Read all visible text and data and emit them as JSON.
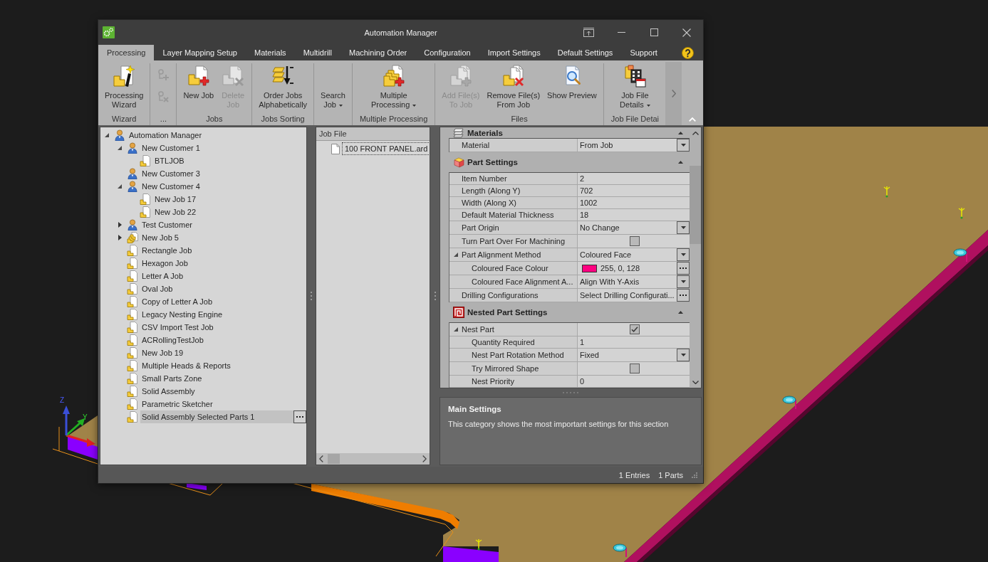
{
  "viewport": {
    "axis_labels": [
      "Z",
      "Y"
    ]
  },
  "window": {
    "title": "Automation Manager"
  },
  "tabs": [
    {
      "label": "Processing",
      "selected": true
    },
    {
      "label": "Layer Mapping Setup",
      "selected": false
    },
    {
      "label": "Materials",
      "selected": false
    },
    {
      "label": "Multidrill",
      "selected": false
    },
    {
      "label": "Machining Order",
      "selected": false
    },
    {
      "label": "Configuration",
      "selected": false
    },
    {
      "label": "Import Settings",
      "selected": false
    },
    {
      "label": "Default Settings",
      "selected": false
    },
    {
      "label": "Support",
      "selected": false
    }
  ],
  "ribbon": {
    "groups": [
      {
        "label": "Wizard",
        "buttons": [
          {
            "kind": "wizard",
            "lines": [
              "Processing",
              "Wizard"
            ],
            "disabled": false,
            "dropdown": false
          }
        ]
      },
      {
        "label": "...",
        "buttons": [
          {
            "kind": "smalladd",
            "disabled": true
          },
          {
            "kind": "smallremove",
            "disabled": true
          }
        ]
      },
      {
        "label": "Jobs",
        "buttons": [
          {
            "kind": "create",
            "lines": [
              "New Job"
            ],
            "disabled": false,
            "dropdown": false
          },
          {
            "kind": "delete",
            "lines": [
              "Delete",
              "Job"
            ],
            "disabled": true,
            "dropdown": false
          }
        ]
      },
      {
        "label": "Jobs Sorting",
        "buttons": [
          {
            "kind": "sort",
            "lines": [
              "Order Jobs",
              "Alphabetically"
            ],
            "disabled": false,
            "dropdown": false
          }
        ]
      },
      {
        "buttons": [
          {
            "kind": "plain",
            "lines": [
              "Search",
              "Job"
            ],
            "disabled": false,
            "dropdown": true
          }
        ]
      },
      {
        "label": "Multiple Processing",
        "buttons": [
          {
            "kind": "batch",
            "lines": [
              "Multiple",
              "Processing"
            ],
            "disabled": false,
            "dropdown": true
          }
        ]
      },
      {
        "label": "Files",
        "buttons": [
          {
            "kind": "addfiles",
            "lines": [
              "Add File(s)",
              "To Job"
            ],
            "disabled": true,
            "dropdown": false
          },
          {
            "kind": "removefiles",
            "lines": [
              "Remove File(s)",
              "From Job"
            ],
            "disabled": false,
            "dropdown": false
          },
          {
            "kind": "preview",
            "lines": [
              "Show Preview"
            ],
            "disabled": false,
            "dropdown": false
          }
        ]
      },
      {
        "label": "Job File Detai",
        "buttons": [
          {
            "kind": "details",
            "lines": [
              "Job File",
              "Details"
            ],
            "disabled": false,
            "dropdown": true
          }
        ]
      }
    ]
  },
  "tree": {
    "items": [
      {
        "label": "Automation Manager",
        "kind": "customer",
        "expanded": true,
        "selected": false,
        "children": [
          {
            "label": "New Customer 1",
            "kind": "customer",
            "expanded": true,
            "selected": false,
            "children": [
              {
                "label": "BTLJOB",
                "kind": "job",
                "selected": false
              }
            ]
          },
          {
            "label": "New Customer 3",
            "kind": "customer",
            "selected": false
          },
          {
            "label": "New Customer 4",
            "kind": "customer",
            "expanded": true,
            "selected": false,
            "children": [
              {
                "label": "New Job 17",
                "kind": "job",
                "selected": false
              },
              {
                "label": "New Job 22",
                "kind": "job",
                "selected": false
              }
            ]
          },
          {
            "label": "Test Customer",
            "kind": "customer",
            "expanded": false,
            "selected": false
          },
          {
            "label": "New Job 5",
            "kind": "jobgroup",
            "expanded": false,
            "selected": false
          },
          {
            "label": "Rectangle Job",
            "kind": "job",
            "selected": false
          },
          {
            "label": "Hexagon Job",
            "kind": "job",
            "selected": false
          },
          {
            "label": "Letter A Job",
            "kind": "job",
            "selected": false
          },
          {
            "label": "Oval Job",
            "kind": "job",
            "selected": false
          },
          {
            "label": "Copy of Letter A Job",
            "kind": "job",
            "selected": false
          },
          {
            "label": "Legacy Nesting Engine",
            "kind": "job",
            "selected": false
          },
          {
            "label": "CSV Import Test Job",
            "kind": "job",
            "selected": false
          },
          {
            "label": "ACRollingTestJob",
            "kind": "job",
            "selected": false
          },
          {
            "label": "New Job 19",
            "kind": "job",
            "selected": false
          },
          {
            "label": "Multiple Heads & Reports",
            "kind": "job",
            "selected": false
          },
          {
            "label": "Small Parts Zone",
            "kind": "job",
            "selected": false
          },
          {
            "label": "Solid Assembly",
            "kind": "job",
            "selected": false
          },
          {
            "label": "Parametric Sketcher",
            "kind": "job",
            "selected": false
          },
          {
            "label": "Solid Assembly Selected Parts 1",
            "kind": "job",
            "selected": true
          }
        ]
      }
    ]
  },
  "job_file": {
    "header": "Job File",
    "files": [
      {
        "label": "100 FRONT PANEL.ard",
        "focused": true
      }
    ]
  },
  "properties": {
    "sections": [
      {
        "title": "Materials",
        "kind": "materials",
        "expanded": true,
        "rows": [
          {
            "label": "Material",
            "value": "From Job",
            "kind": "dropdown"
          }
        ]
      },
      {
        "title": "Part Settings",
        "kind": "part",
        "expanded": true,
        "rows": [
          {
            "label": "Item Number",
            "value": "2",
            "kind": "text"
          },
          {
            "label": "Length (Along Y)",
            "value": "702",
            "kind": "text"
          },
          {
            "label": "Width (Along X)",
            "value": "1002",
            "kind": "text"
          },
          {
            "label": "Default Material Thickness",
            "value": "18",
            "kind": "text"
          },
          {
            "label": "Part Origin",
            "value": "No Change",
            "kind": "dropdown"
          },
          {
            "label": "Turn Part Over For Machining",
            "kind": "checkbox",
            "checked": false
          },
          {
            "label": "Part Alignment Method",
            "value": "Coloured Face",
            "kind": "dropdown",
            "expanded": true,
            "children": [
              {
                "label": "Coloured Face Colour",
                "value": "255, 0, 128",
                "kind": "colour",
                "color": "#ff0080"
              },
              {
                "label": "Coloured Face Alignment A...",
                "value": "Align With Y-Axis",
                "kind": "dropdown"
              }
            ]
          },
          {
            "label": "Drilling Configurations",
            "value": "Select Drilling Configurati...",
            "kind": "ellipsis"
          }
        ]
      },
      {
        "title": "Nested Part Settings",
        "kind": "nesting",
        "expanded": true,
        "rows": [
          {
            "label": "Nest Part",
            "kind": "checkbox",
            "checked": true,
            "expanded": true,
            "children": [
              {
                "label": "Quantity Required",
                "value": "1",
                "kind": "text"
              },
              {
                "label": "Nest Part Rotation Method",
                "value": "Fixed",
                "kind": "dropdown"
              },
              {
                "label": "Try Mirrored Shape",
                "kind": "checkbox",
                "checked": false
              },
              {
                "label": "Nest Priority",
                "value": "0",
                "kind": "text"
              }
            ]
          }
        ]
      }
    ]
  },
  "description": {
    "title": "Main Settings",
    "text": "This category shows the most important settings for this section"
  },
  "status_bar": [
    "1 Entries",
    "1 Parts"
  ]
}
